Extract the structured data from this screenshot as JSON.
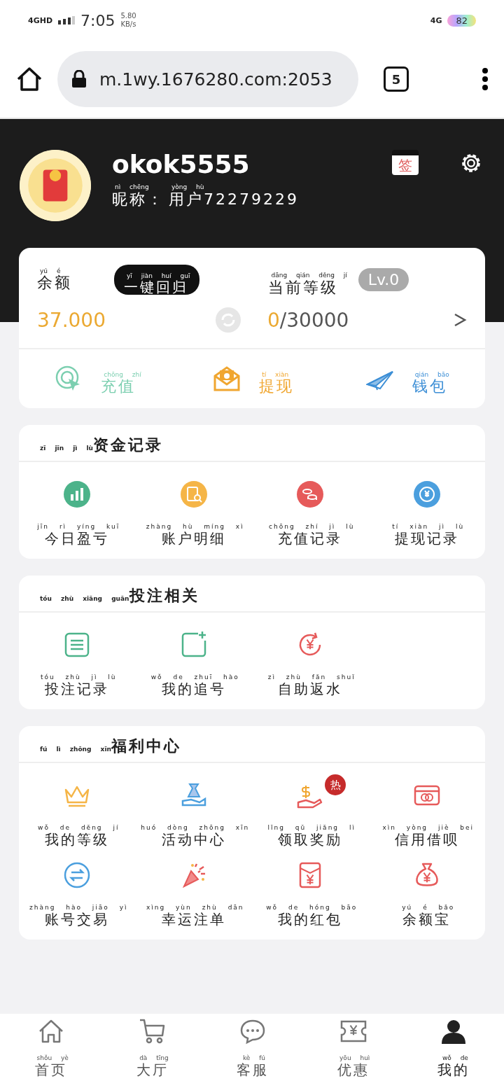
{
  "status_bar": {
    "network": "4GHD",
    "time": "7:05",
    "speed": "5.80",
    "speed_unit": "KB/s",
    "network_right": "4G",
    "battery": "82"
  },
  "browser": {
    "url": "m.1wy.1676280.com:2053",
    "tab_count": "5"
  },
  "profile": {
    "username": "okok5555",
    "nickname_label": {
      "text": "昵称：",
      "pinyin": "nì chēng"
    },
    "nickname_value": {
      "text": "用户72279229",
      "pinyin": "yòng hù"
    },
    "sign_label": "签"
  },
  "wallet": {
    "balance_label": {
      "text": "余额",
      "pinyin": "yú é"
    },
    "recall_button": {
      "text": "一键回归",
      "pinyin": "yī jiàn huí guī"
    },
    "level_label": {
      "text": "当前等级",
      "pinyin": "dāng qián děng jí"
    },
    "level_badge": "Lv.0",
    "balance": "37.000",
    "progress_current": "0",
    "progress_total": "/30000",
    "actions": [
      {
        "kind": "recharge",
        "text": "充值",
        "pinyin": "chōng zhí",
        "color": "#7ccfb0"
      },
      {
        "kind": "withdraw",
        "text": "提现",
        "pinyin": "tí xiàn",
        "color": "#f0a630"
      },
      {
        "kind": "wallet",
        "text": "钱包",
        "pinyin": "qián bāo",
        "color": "#3d8fd6"
      }
    ]
  },
  "sections": [
    {
      "title": {
        "text": "资金记录",
        "pinyin": "zī jīn jì lù"
      },
      "items": [
        {
          "kind": "chart",
          "text": "今日盈亏",
          "pinyin": "jīn rì yíng kuī"
        },
        {
          "kind": "statement",
          "text": "账户明细",
          "pinyin": "zhàng hù míng xì"
        },
        {
          "kind": "coins",
          "text": "充值记录",
          "pinyin": "chōng zhí jì lù"
        },
        {
          "kind": "exchange-coin",
          "text": "提现记录",
          "pinyin": "tí xiàn jì lù"
        }
      ]
    },
    {
      "title": {
        "text": "投注相关",
        "pinyin": "tóu zhù xiāng guān"
      },
      "items": [
        {
          "kind": "list",
          "text": "投注记录",
          "pinyin": "tóu zhù jì lù"
        },
        {
          "kind": "add",
          "text": "我的追号",
          "pinyin": "wǒ de zhuī hào"
        },
        {
          "kind": "refund",
          "text": "自助返水",
          "pinyin": "zì zhù fǎn shuǐ"
        }
      ]
    },
    {
      "title": {
        "text": "福利中心",
        "pinyin": "fú lì zhōng xīn"
      },
      "items": [
        {
          "kind": "crown",
          "text": "我的等级",
          "pinyin": "wǒ de děng jí"
        },
        {
          "kind": "gift-hand",
          "text": "活动中心",
          "pinyin": "huó dòng zhōng xīn"
        },
        {
          "kind": "money-hand",
          "text": "领取奖励",
          "pinyin": "lǐng qǔ jiǎng lì",
          "badge": "热"
        },
        {
          "kind": "card",
          "text": "信用借呗",
          "pinyin": "xìn yòng jiè bei"
        },
        {
          "kind": "swap",
          "text": "账号交易",
          "pinyin": "zhàng hào jiāo yì"
        },
        {
          "kind": "party",
          "text": "幸运注单",
          "pinyin": "xìng yùn zhù dān"
        },
        {
          "kind": "envelope",
          "text": "我的红包",
          "pinyin": "wǒ de hóng bāo"
        },
        {
          "kind": "moneybag",
          "text": "余额宝",
          "pinyin": "yú é bǎo"
        }
      ]
    }
  ],
  "bottom_nav": [
    {
      "kind": "home",
      "text": "首页",
      "pinyin": "shǒu yè",
      "selected": false
    },
    {
      "kind": "cart",
      "text": "大厅",
      "pinyin": "dà tīng",
      "selected": false
    },
    {
      "kind": "chat",
      "text": "客服",
      "pinyin": "kè fú",
      "selected": false
    },
    {
      "kind": "ticket",
      "text": "优惠",
      "pinyin": "yōu huì",
      "selected": false
    },
    {
      "kind": "person",
      "text": "我的",
      "pinyin": "wǒ de",
      "selected": true
    }
  ]
}
